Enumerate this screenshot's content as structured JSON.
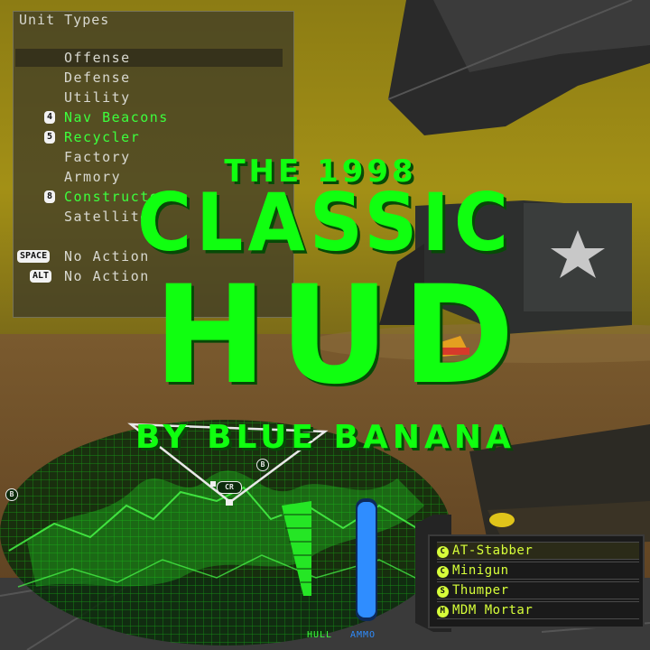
{
  "unit_menu": {
    "title": "Unit Types",
    "items": [
      {
        "label": "Offense",
        "hotkey": "",
        "available": false,
        "selected": true
      },
      {
        "label": "Defense",
        "hotkey": "",
        "available": false,
        "selected": false
      },
      {
        "label": "Utility",
        "hotkey": "",
        "available": false,
        "selected": false
      },
      {
        "label": "Nav Beacons",
        "hotkey": "4",
        "available": true,
        "selected": false
      },
      {
        "label": "Recycler",
        "hotkey": "5",
        "available": true,
        "selected": false
      },
      {
        "label": "Factory",
        "hotkey": "",
        "available": false,
        "selected": false
      },
      {
        "label": "Armory",
        "hotkey": "",
        "available": false,
        "selected": false
      },
      {
        "label": "Constructor",
        "hotkey": "8",
        "available": true,
        "selected": false
      },
      {
        "label": "Satellite",
        "hotkey": "",
        "available": false,
        "selected": false
      }
    ],
    "actions": [
      {
        "key": "SPACE",
        "label": "No Action"
      },
      {
        "key": "ALT",
        "label": "No Action"
      }
    ]
  },
  "title": {
    "line1": "THE 1998",
    "line2": "CLASSIC",
    "line3": "HUD",
    "line4": "BY BLUE BANANA"
  },
  "radar": {
    "markers": [
      {
        "label": "B"
      },
      {
        "label": "CR"
      },
      {
        "label": "B"
      }
    ]
  },
  "gauges": {
    "hull_label": "HULL",
    "ammo_label": "AMMO",
    "hull_level": 0.9,
    "ammo_level": 0.95
  },
  "weapons": [
    {
      "glyph": "C",
      "label": "AT-Stabber",
      "active": true
    },
    {
      "glyph": "C",
      "label": "Minigun",
      "active": false
    },
    {
      "glyph": "S",
      "label": "Thumper",
      "active": false
    },
    {
      "glyph": "M",
      "label": "MDM Mortar",
      "active": false
    }
  ],
  "colors": {
    "hud_green": "#10ff10",
    "menu_text": "#d8d8d0",
    "weapon_text": "#d7ff3a",
    "ammo_blue": "#2f8dff",
    "sky": "#8a7a12"
  }
}
